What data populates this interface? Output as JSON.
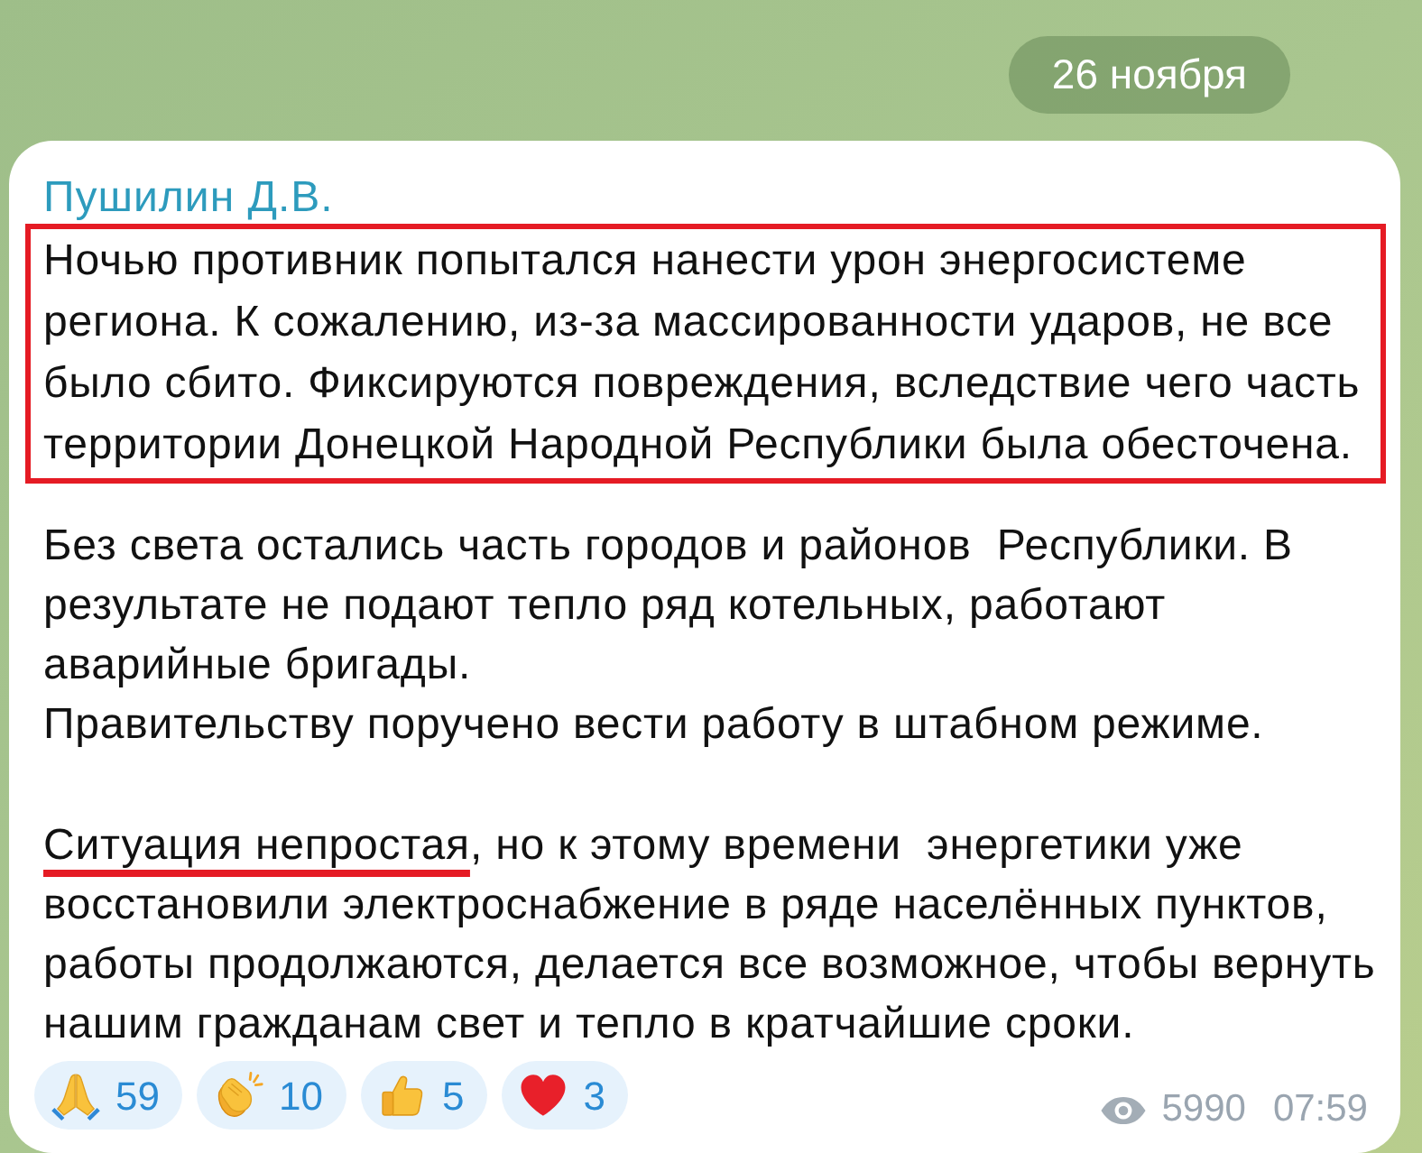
{
  "date_badge": "26 ноября",
  "message": {
    "author": "Пушилин Д.В.",
    "paragraphs": [
      {
        "boxed": true,
        "lines": [
          [
            {
              "text": "Ночью противник попытался нанести урон энергосистеме",
              "underlined": false
            }
          ],
          [
            {
              "text": "региона. К сожалению, из-за массированности ударов, не все",
              "underlined": false
            }
          ],
          [
            {
              "text": "было сбито. Фиксируются повреждения, вследствие чего часть",
              "underlined": false
            }
          ],
          [
            {
              "text": "территории Донецкой Народной Республики была обесточена.",
              "underlined": false
            }
          ]
        ]
      },
      {
        "boxed": false,
        "lines": [
          [
            {
              "text": "Без света остались часть городов и районов  Республики. В",
              "underlined": false
            }
          ],
          [
            {
              "text": "результате не подают тепло ряд котельных, работают",
              "underlined": false
            }
          ],
          [
            {
              "text": "аварийные бригады.",
              "underlined": false
            }
          ],
          [
            {
              "text": "Правительству поручено вести работу в штабном режиме.",
              "underlined": false
            }
          ]
        ]
      },
      {
        "boxed": false,
        "lines": [
          [
            {
              "text": "Ситуация непростая",
              "underlined": true
            },
            {
              "text": ", но к этому времени  энергетики уже",
              "underlined": false
            }
          ],
          [
            {
              "text": "восстановили электроснабжение в ряде населённых пунктов,",
              "underlined": false
            }
          ],
          [
            {
              "text": "работы продолжаются, делается все возможное, чтобы вернуть",
              "underlined": false
            }
          ],
          [
            {
              "text": "нашим гражданам свет и тепло в кратчайшие сроки.",
              "underlined": false
            }
          ]
        ]
      }
    ],
    "reactions": [
      {
        "kind": "pray",
        "count": "59",
        "selected": false
      },
      {
        "kind": "clap",
        "count": "10",
        "selected": false
      },
      {
        "kind": "thumbs_up",
        "count": "5",
        "selected": false
      },
      {
        "kind": "heart",
        "count": "3",
        "selected": false
      }
    ],
    "views": "5990",
    "time": "07:59"
  }
}
